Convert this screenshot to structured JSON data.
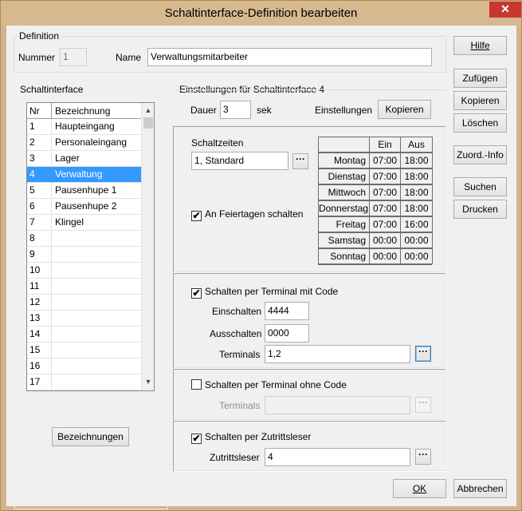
{
  "window": {
    "title": "Schaltinterface-Definition bearbeiten",
    "close_label": "✕"
  },
  "definition": {
    "group_title": "Definition",
    "nummer_label": "Nummer",
    "nummer_value": "1",
    "name_label": "Name",
    "name_value": "Verwaltungsmitarbeiter"
  },
  "schaltinterface": {
    "group_title": "Schaltinterface",
    "columns": [
      "Nr",
      "Bezeichnung"
    ],
    "rows": [
      {
        "nr": "1",
        "name": "Haupteingang"
      },
      {
        "nr": "2",
        "name": "Personaleingang"
      },
      {
        "nr": "3",
        "name": "Lager"
      },
      {
        "nr": "4",
        "name": "Verwaltung"
      },
      {
        "nr": "5",
        "name": "Pausenhupe 1"
      },
      {
        "nr": "6",
        "name": "Pausenhupe 2"
      },
      {
        "nr": "7",
        "name": "Klingel"
      },
      {
        "nr": "8",
        "name": ""
      },
      {
        "nr": "9",
        "name": ""
      },
      {
        "nr": "10",
        "name": ""
      },
      {
        "nr": "11",
        "name": ""
      },
      {
        "nr": "12",
        "name": ""
      },
      {
        "nr": "13",
        "name": ""
      },
      {
        "nr": "14",
        "name": ""
      },
      {
        "nr": "15",
        "name": ""
      },
      {
        "nr": "16",
        "name": ""
      },
      {
        "nr": "17",
        "name": ""
      }
    ],
    "selected_index": 3,
    "scroll_up": "▲",
    "scroll_down": "▼",
    "bezeichnungen_button": "Bezeichnungen"
  },
  "einstellungen": {
    "group_title": "Einstellungen für Schaltinterface 4",
    "dauer_label": "Dauer",
    "dauer_value": "3",
    "dauer_unit": "sek",
    "einstellungen_label": "Einstellungen",
    "kopieren_button": "Kopieren",
    "schaltzeiten_label": "Schaltzeiten",
    "schaltzeiten_value": "1, Standard",
    "ellipsis": "···",
    "feiertage_label": "An Feiertagen schalten",
    "feiertage_checked": true,
    "schedule": {
      "col_ein": "Ein",
      "col_aus": "Aus",
      "days": [
        {
          "day": "Montag",
          "ein": "07:00",
          "aus": "18:00"
        },
        {
          "day": "Dienstag",
          "ein": "07:00",
          "aus": "18:00"
        },
        {
          "day": "Mittwoch",
          "ein": "07:00",
          "aus": "18:00"
        },
        {
          "day": "Donnerstag",
          "ein": "07:00",
          "aus": "18:00"
        },
        {
          "day": "Freitag",
          "ein": "07:00",
          "aus": "16:00"
        },
        {
          "day": "Samstag",
          "ein": "00:00",
          "aus": "00:00"
        },
        {
          "day": "Sonntag",
          "ein": "00:00",
          "aus": "00:00"
        }
      ]
    },
    "mit_code": {
      "label": "Schalten per Terminal mit Code",
      "checked": true,
      "einschalten_label": "Einschalten",
      "einschalten_value": "4444",
      "ausschalten_label": "Ausschalten",
      "ausschalten_value": "0000",
      "terminals_label": "Terminals",
      "terminals_value": "1,2"
    },
    "ohne_code": {
      "label": "Schalten per Terminal ohne Code",
      "checked": false,
      "terminals_label": "Terminals",
      "terminals_value": ""
    },
    "zutritt": {
      "label": "Schalten per Zutrittsleser",
      "checked": true,
      "leser_label": "Zutrittsleser",
      "leser_value": "4"
    }
  },
  "side_buttons": {
    "hilfe": "Hilfe",
    "zufuegen": "Zufügen",
    "kopieren": "Kopieren",
    "loeschen": "Löschen",
    "zuord_info": "Zuord.-Info",
    "suchen": "Suchen",
    "drucken": "Drucken"
  },
  "bottom_buttons": {
    "ok": "OK",
    "abbrechen": "Abbrechen"
  },
  "check_mark": "✔"
}
